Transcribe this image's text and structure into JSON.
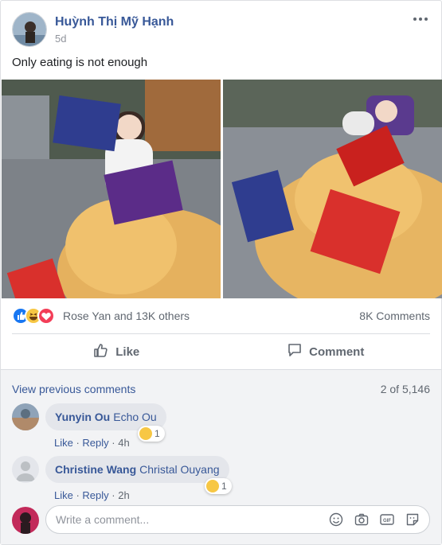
{
  "post": {
    "author": "Huỳnh Thị Mỹ Hạnh",
    "time": "5d",
    "text": "Only eating is not enough"
  },
  "reactions": {
    "types": [
      "like-icon",
      "haha-icon",
      "love-icon"
    ],
    "names": "Rose Yan and 13K others",
    "comments_count": "8K Comments"
  },
  "actions": {
    "like_label": "Like",
    "comment_label": "Comment"
  },
  "comments": {
    "view_previous": "View previous comments",
    "pager": "2 of 5,146",
    "items": [
      {
        "name": "Yunyin Ou",
        "tag": "Echo Ou",
        "like": "Like",
        "reply": "Reply",
        "time": "4h",
        "reaction_count": "1"
      },
      {
        "name": "Christine Wang",
        "tag": "Christal Ouyang",
        "like": "Like",
        "reply": "Reply",
        "time": "2h",
        "reaction_count": "1"
      }
    ],
    "write_placeholder": "Write a comment..."
  },
  "colors": {
    "link": "#385898",
    "like_blue": "#1877f2",
    "haha_yellow": "#f7c744",
    "love_red": "#f33e58",
    "comment_bg": "#f2f3f5"
  }
}
